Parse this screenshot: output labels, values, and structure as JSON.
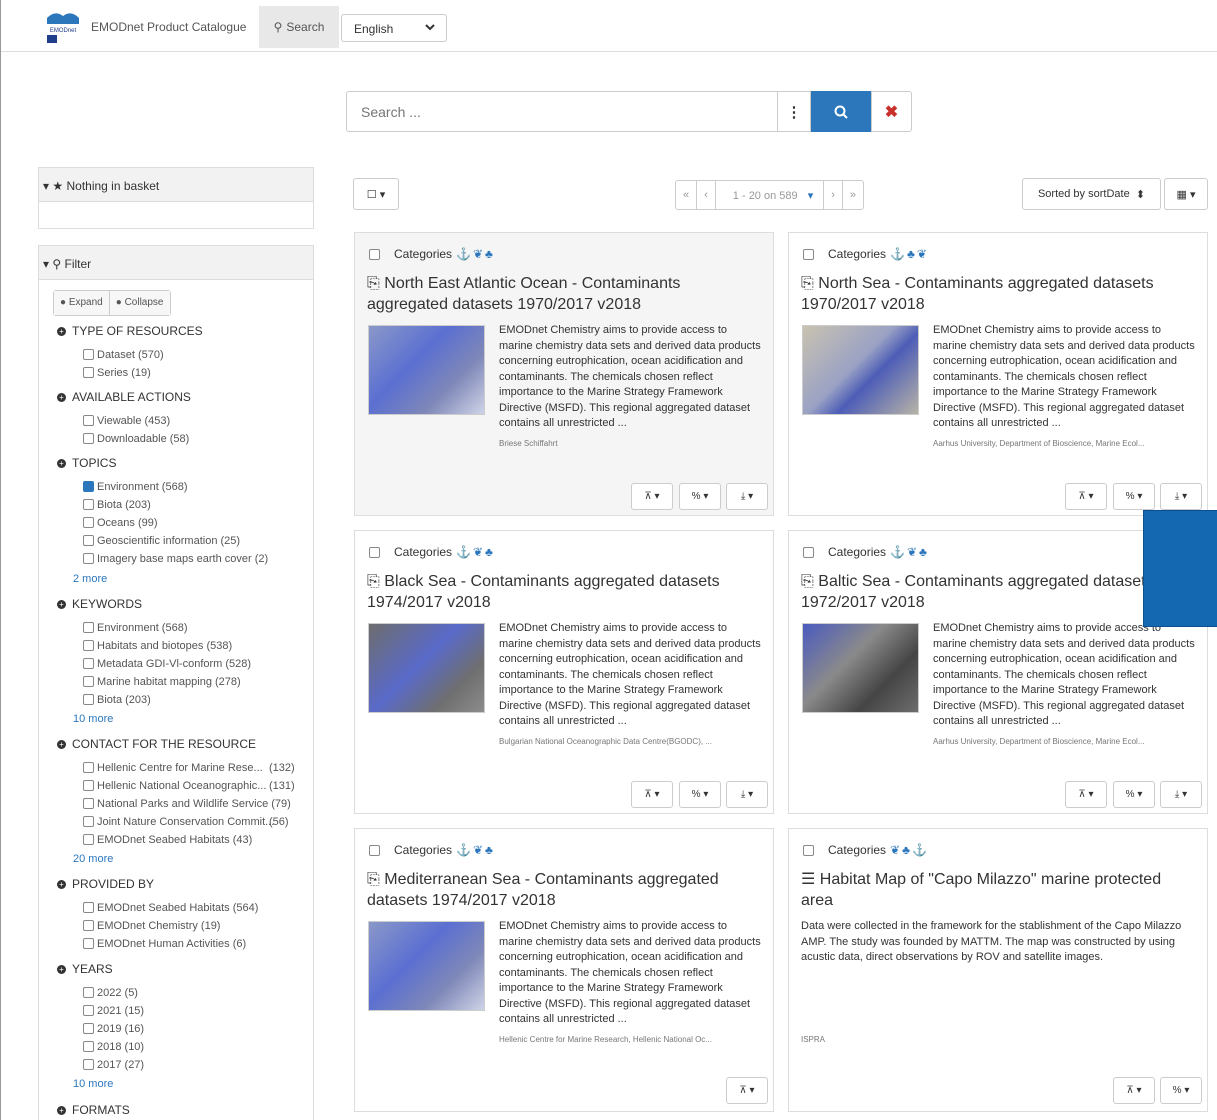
{
  "nav": {
    "brand": "EMODnet Product Catalogue",
    "search_tab": "Search",
    "language": "English",
    "logo_text": "EMODnet"
  },
  "search": {
    "placeholder": "Search ..."
  },
  "basket": {
    "title": "Nothing in basket"
  },
  "filter": {
    "title": "Filter",
    "expand": "Expand",
    "collapse": "Collapse",
    "sections": [
      {
        "title": "TYPE OF RESOURCES",
        "items": [
          {
            "label": "Dataset (570)"
          },
          {
            "label": "Series (19)"
          }
        ]
      },
      {
        "title": "AVAILABLE ACTIONS",
        "items": [
          {
            "label": "Viewable (453)"
          },
          {
            "label": "Downloadable (58)"
          }
        ]
      },
      {
        "title": "TOPICS",
        "items": [
          {
            "label": "Environment (568)",
            "checked": true
          },
          {
            "label": "Biota (203)"
          },
          {
            "label": "Oceans (99)"
          },
          {
            "label": "Geoscientific information (25)"
          },
          {
            "label": "Imagery base maps earth cover (2)"
          }
        ],
        "more": "2 more"
      },
      {
        "title": "KEYWORDS",
        "items": [
          {
            "label": "Environment (568)"
          },
          {
            "label": "Habitats and biotopes (538)"
          },
          {
            "label": "Metadata GDI-Vl-conform (528)"
          },
          {
            "label": "Marine habitat mapping (278)"
          },
          {
            "label": "Biota (203)"
          }
        ],
        "more": "10 more"
      },
      {
        "title": "CONTACT FOR THE RESOURCE",
        "items": [
          {
            "label": "Hellenic Centre for Marine Rese...",
            "count": "(132)"
          },
          {
            "label": "Hellenic National Oceanographic...",
            "count": "(131)"
          },
          {
            "label": "National Parks and Wildlife Service (79)"
          },
          {
            "label": "Joint Nature Conservation Commit...",
            "count": "(56)"
          },
          {
            "label": "EMODnet Seabed Habitats (43)"
          }
        ],
        "more": "20 more"
      },
      {
        "title": "PROVIDED BY",
        "items": [
          {
            "label": "EMODnet Seabed Habitats (564)"
          },
          {
            "label": "EMODnet Chemistry (19)"
          },
          {
            "label": "EMODnet Human Activities (6)"
          }
        ]
      },
      {
        "title": "YEARS",
        "items": [
          {
            "label": "2022 (5)"
          },
          {
            "label": "2021 (15)"
          },
          {
            "label": "2019 (16)"
          },
          {
            "label": "2018 (10)"
          },
          {
            "label": "2017 (27)"
          }
        ],
        "more": "10 more"
      },
      {
        "title": "FORMATS",
        "items": []
      }
    ]
  },
  "toolbar": {
    "pagination": "1 - 20 on 589",
    "first": "«",
    "prev": "‹",
    "next": "›",
    "last": "»",
    "sort": "Sorted by sortDate"
  },
  "results": [
    {
      "categories": "Categories",
      "title": "North East Atlantic Ocean - Contaminants aggregated datasets 1970/2017 v2018",
      "description": "EMODnet Chemistry aims to provide access to marine chemistry data sets and derived data products concerning eutrophication, ocean acidification and contaminants. The chemicals chosen reflect importance to the Marine Strategy Framework Directive (MSFD). This regional aggregated dataset contains all unrestricted ...",
      "owner": "Briese Schiffahrt"
    },
    {
      "categories": "Categories",
      "title": "North Sea - Contaminants aggregated datasets 1970/2017 v2018",
      "description": "EMODnet Chemistry aims to provide access to marine chemistry data sets and derived data products concerning eutrophication, ocean acidification and contaminants. The chemicals chosen reflect importance to the Marine Strategy Framework Directive (MSFD). This regional aggregated dataset contains all unrestricted ...",
      "owner": "Aarhus University, Department of Bioscience, Marine Ecol..."
    },
    {
      "categories": "Categories",
      "title": "Black Sea - Contaminants aggregated datasets 1974/2017 v2018",
      "description": "EMODnet Chemistry aims to provide access to marine chemistry data sets and derived data products concerning eutrophication, ocean acidification and contaminants. The chemicals chosen reflect importance to the Marine Strategy Framework Directive (MSFD). This regional aggregated dataset contains all unrestricted ...",
      "owner": "Bulgarian National Oceanographic Data Centre(BGODC), ..."
    },
    {
      "categories": "Categories",
      "title": "Baltic Sea - Contaminants aggregated datasets 1972/2017 v2018",
      "description": "EMODnet Chemistry aims to provide access to marine chemistry data sets and derived data products concerning eutrophication, ocean acidification and contaminants. The chemicals chosen reflect importance to the Marine Strategy Framework Directive (MSFD). This regional aggregated dataset contains all unrestricted ...",
      "owner": "Aarhus University, Department of Bioscience, Marine Ecol..."
    },
    {
      "categories": "Categories",
      "title": "Mediterranean Sea - Contaminants aggregated datasets 1974/2017 v2018",
      "description": "EMODnet Chemistry aims to provide access to marine chemistry data sets and derived data products concerning eutrophication, ocean acidification and contaminants. The chemicals chosen reflect importance to the Marine Strategy Framework Directive (MSFD). This regional aggregated dataset contains all unrestricted ...",
      "owner": "Hellenic Centre for Marine Research, Hellenic National Oc..."
    },
    {
      "categories": "Categories",
      "title": "Habitat Map of \"Capo Milazzo\" marine protected area",
      "description": "Data were collected in the framework for the stablishment of the Capo Milazzo AMP. The study was founded by MATTM. The map was constructed by using acustic data, direct observations by ROV and satellite images.",
      "owner": "ISPRA"
    }
  ],
  "colors": {
    "accent": "#2c77bc",
    "clear": "#c9302c",
    "overlay": "#1467b1"
  }
}
